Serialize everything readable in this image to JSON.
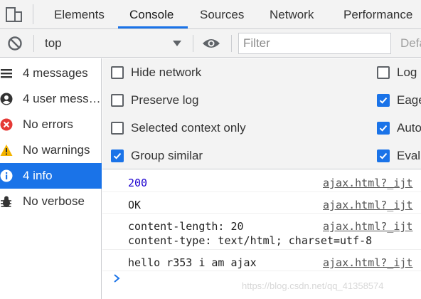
{
  "tabs": [
    {
      "label": "Elements"
    },
    {
      "label": "Console"
    },
    {
      "label": "Sources"
    },
    {
      "label": "Network"
    },
    {
      "label": "Performance"
    }
  ],
  "active_tab": "Console",
  "toolbar": {
    "context": "top",
    "filter_placeholder": "Filter",
    "levels_label": "Defa"
  },
  "sidebar": {
    "items": [
      {
        "label": "4 messages",
        "icon": "list-icon"
      },
      {
        "label": "4 user mess…",
        "icon": "user-icon"
      },
      {
        "label": "No errors",
        "icon": "error-icon"
      },
      {
        "label": "No warnings",
        "icon": "warning-icon"
      },
      {
        "label": "4 info",
        "icon": "info-icon"
      },
      {
        "label": "No verbose",
        "icon": "bug-icon"
      }
    ],
    "selected": "4 info"
  },
  "settings": {
    "left": [
      {
        "label": "Hide network",
        "checked": false
      },
      {
        "label": "Preserve log",
        "checked": false
      },
      {
        "label": "Selected context only",
        "checked": false
      },
      {
        "label": "Group similar",
        "checked": true
      }
    ],
    "right": [
      {
        "label": "Log",
        "checked": false
      },
      {
        "label": "Eage",
        "checked": true
      },
      {
        "label": "Auto",
        "checked": true
      },
      {
        "label": "Evalu",
        "checked": true
      }
    ]
  },
  "messages": [
    {
      "text": "200",
      "source": "ajax.html?_ijt"
    },
    {
      "text": "OK",
      "source": "ajax.html?_ijt"
    },
    {
      "text": "content-length: 20\ncontent-type: text/html; charset=utf-8",
      "source": "ajax.html?_ijt"
    },
    {
      "text": "hello r353 i am ajax",
      "source": "ajax.html?_ijt"
    }
  ],
  "watermark": "https://blog.csdn.net/qq_41358574",
  "colors": {
    "accent": "#1a73e8",
    "number": "#1c00cf",
    "error": "#e53935",
    "warning": "#f4b400"
  }
}
